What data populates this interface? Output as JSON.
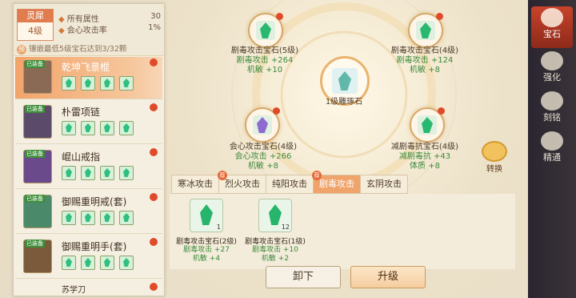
{
  "left_panel": {
    "rank_title": "灵犀",
    "rank_level": "4级",
    "stats": [
      {
        "label": "所有属性",
        "value": "30"
      },
      {
        "label": "会心攻击率",
        "value": "1%"
      }
    ],
    "set_badge": "预",
    "set_note": "镶嵌最低5级宝石达到3/32颗",
    "equip_badge": "已装备",
    "items": [
      {
        "name": "乾坤飞景棍"
      },
      {
        "name": "朴雷项链"
      },
      {
        "name": "崐山戒指"
      },
      {
        "name": "御赐重明戒(套)"
      },
      {
        "name": "御赐重明手(套)"
      },
      {
        "name": "苏学刀"
      }
    ]
  },
  "slots": {
    "top_left": {
      "name": "剧毒攻击宝石(5级)",
      "stat1": "剧毒攻击 +264",
      "stat2": "机敏 +10"
    },
    "top_right": {
      "name": "剧毒攻击宝石(4级)",
      "stat1": "剧毒攻击 +124",
      "stat2": "机敏 +8"
    },
    "center": {
      "name": "1级雕琢石"
    },
    "bottom_left": {
      "name": "会心攻击宝石(4级)",
      "stat1": "会心攻击 +266",
      "stat2": "机敏 +8"
    },
    "bottom_right": {
      "name": "减剧毒抗宝石(4级)",
      "stat1": "减剧毒抗 +43",
      "stat2": "体质 +8"
    }
  },
  "swap_label": "转换",
  "tabs": [
    "寒冰攻击",
    "烈火攻击",
    "纯阳攻击",
    "剧毒攻击",
    "玄阴攻击"
  ],
  "tab_marker": "荐",
  "gem_cards": [
    {
      "name": "剧毒攻击宝石(2级)",
      "count": "1",
      "stat1": "剧毒攻击 +27",
      "stat2": "机敏 +4"
    },
    {
      "name": "剧毒攻击宝石(1级)",
      "count": "12",
      "stat1": "剧毒攻击 +10",
      "stat2": "机敏 +2"
    }
  ],
  "buttons": {
    "unequip": "卸下",
    "upgrade": "升级"
  },
  "nav": [
    {
      "label": "宝石"
    },
    {
      "label": "强化"
    },
    {
      "label": "刻铭"
    },
    {
      "label": "精通"
    }
  ],
  "colors": {
    "accent": "#e07c4e",
    "nav_active": "#c8432b",
    "stat_green": "#3b8a3b"
  }
}
